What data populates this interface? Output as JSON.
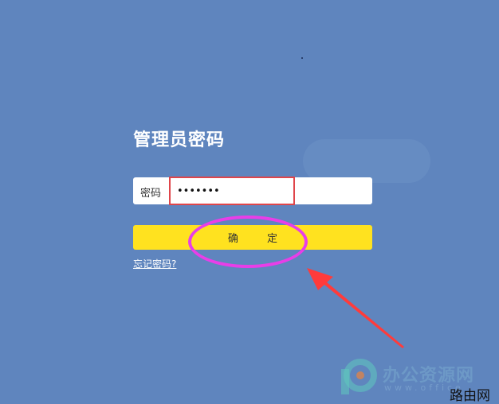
{
  "title": "管理员密码",
  "password_field": {
    "label": "密码",
    "value": "•••••••"
  },
  "confirm_label": "确 定",
  "forgot_link": "忘记密码?",
  "watermark": {
    "chinese": "办公资源网",
    "english": "www.office"
  },
  "site_tag": "路由网",
  "colors": {
    "background": "#5f85be",
    "confirm_button": "#ffe21f",
    "highlight_box": "#e0454a",
    "annotation_ellipse": "#e83ee8",
    "arrow": "#ff3b3b"
  }
}
